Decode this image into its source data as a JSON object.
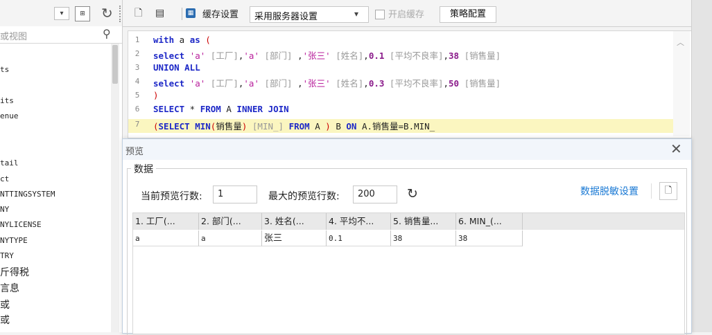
{
  "left_panel": {
    "search_placeholder": "或视图",
    "tree": [
      "ts",
      "its",
      "enue",
      "tail",
      "ct",
      "NTTINGSYSTEM",
      "NY",
      "NYLICENSE",
      "NYTYPE",
      "TRY",
      "斤得税",
      "言息",
      "或",
      "或"
    ]
  },
  "toolbar": {
    "cache_label": "缓存设置",
    "cache_select": "采用服务器设置",
    "cache_check_label": "开启缓存",
    "policy_button": "策略配置"
  },
  "editor": {
    "lines": [
      "1",
      "2",
      "3",
      "4",
      "5",
      "6",
      "7"
    ]
  },
  "preview": {
    "title": "预览",
    "group_label": "数据",
    "current_rows_label": "当前预览行数:",
    "current_rows": "1",
    "max_rows_label": "最大的预览行数:",
    "max_rows": "200",
    "mask_link": "数据脱敏设置",
    "columns": [
      "1. 工厂(...",
      "2. 部门(...",
      "3. 姓名(...",
      "4. 平均不...",
      "5. 销售量...",
      "6. MIN_(..."
    ],
    "rows": [
      [
        "a",
        "a",
        "张三",
        "0.1",
        "38",
        "38"
      ]
    ]
  },
  "colors": {
    "keyword": "#1d28c7",
    "string": "#b81d9b",
    "highlight": "#fbf6c0",
    "link": "#1a79d4"
  }
}
